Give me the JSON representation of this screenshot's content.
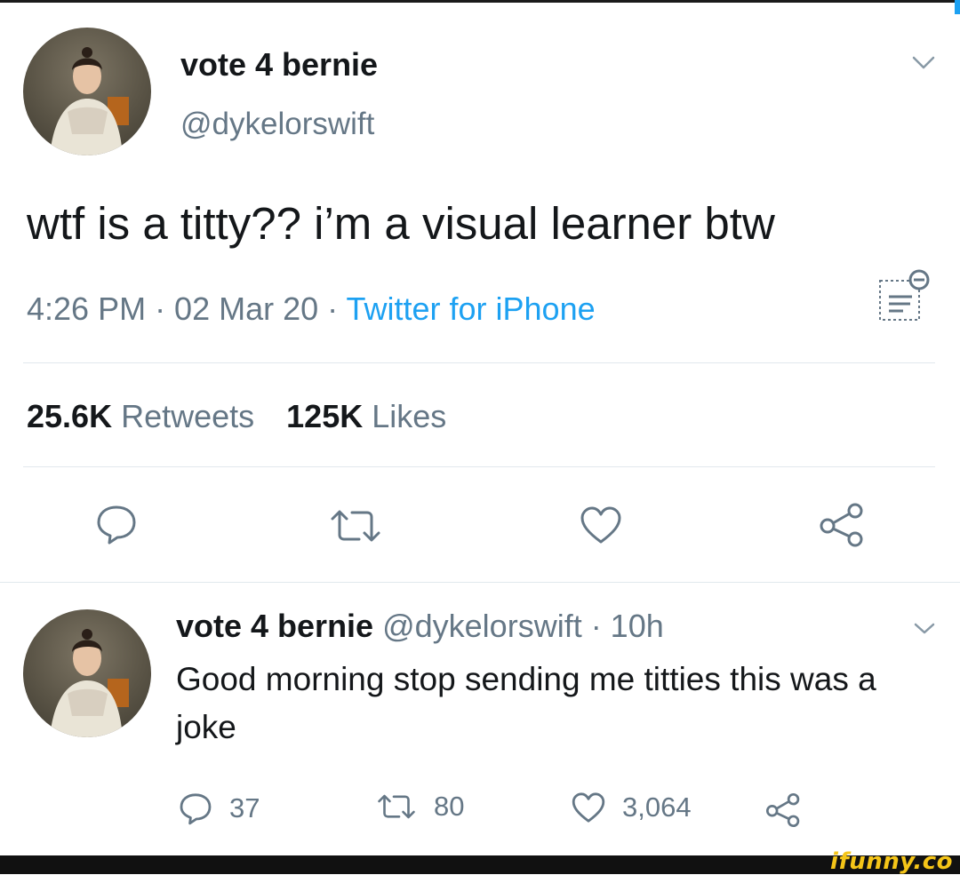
{
  "tweet": {
    "display_name": "vote 4 bernie",
    "handle": "@dykelorswift",
    "text": "wtf is a titty?? i’m a visual learner btw",
    "time": "4:26 PM · 02 Mar 20 · ",
    "source": "Twitter for iPhone",
    "retweets_count": "25.6K",
    "retweets_label": " Retweets",
    "likes_count": "125K",
    "likes_label": " Likes"
  },
  "reply": {
    "display_name": "vote 4 bernie",
    "meta": " @dykelorswift · 10h",
    "text": "Good morning stop sending me titties this was a joke",
    "replies": "37",
    "retweets": "80",
    "likes": "3,064"
  },
  "watermark": "ifunny.co",
  "colors": {
    "accent": "#1da1f2",
    "secondary_text": "#657786",
    "primary_text": "#14171a"
  },
  "icons": [
    "chevron-down-icon",
    "analytics-icon",
    "reply-icon",
    "retweet-icon",
    "like-icon",
    "share-icon"
  ]
}
